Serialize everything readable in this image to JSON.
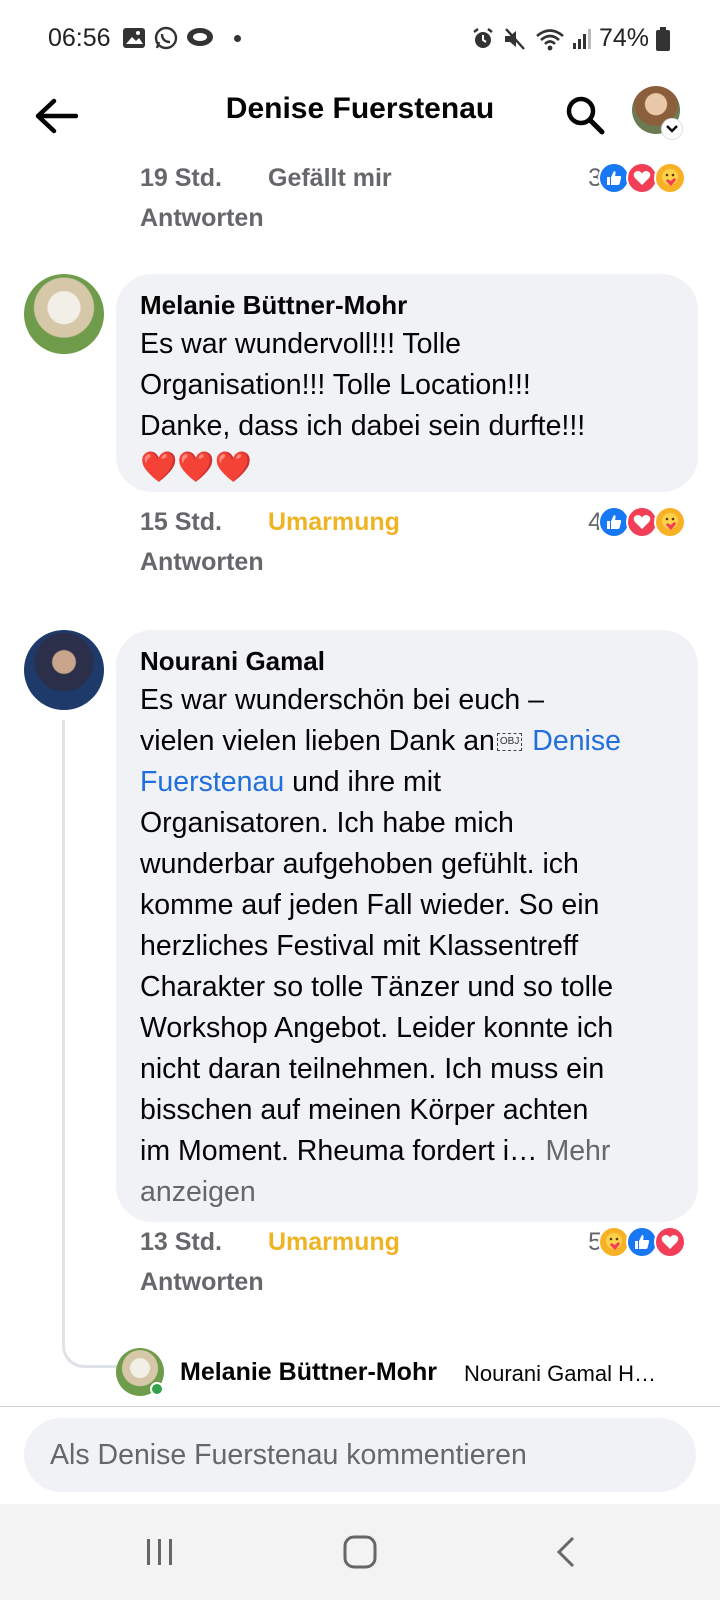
{
  "status_bar": {
    "time": "06:56",
    "battery": "74%"
  },
  "app_bar": {
    "title": "Denise Fuerstenau"
  },
  "top_meta": {
    "time": "19 Std.",
    "reaction": "Gefällt mir",
    "reply": "Antworten",
    "count": "3"
  },
  "comments": [
    {
      "author": "Melanie Büttner-Mohr",
      "lines": [
        "Es war wundervoll!!! Tolle",
        "Organisation!!! Tolle Location!!!",
        "Danke, dass ich dabei sein durfte!!!"
      ],
      "emoji": "❤️❤️❤️",
      "time": "15 Std.",
      "reaction": "Umarmung",
      "reply": "Antworten",
      "count": "4"
    },
    {
      "author": "Nourani Gamal",
      "line1": "Es war wunderschön bei euch –",
      "line2_pre": "vielen vielen lieben Dank an",
      "obj_marker": "OBJ",
      "mention_part1": " Denise",
      "mention_part2": "Fuerstenau",
      "line3_post": " und ihre mit",
      "lines_rest": [
        "Organisatoren. Ich habe mich",
        "wunderbar aufgehoben gefühlt. ich",
        "komme auf jeden Fall wieder. So ein",
        "herzliches Festival mit Klassentreff",
        "Charakter so tolle Tänzer und so tolle",
        "Workshop Angebot. Leider konnte ich",
        "nicht daran teilnehmen. Ich muss ein",
        "bisschen auf meinen Körper achten"
      ],
      "last_line": "im Moment. Rheuma fordert i…",
      "more_1": " Mehr",
      "more_2": "anzeigen",
      "time": "13 Std.",
      "reaction": "Umarmung",
      "reply": "Antworten",
      "count": "5"
    }
  ],
  "reply_preview": {
    "author": "Melanie Büttner-Mohr",
    "snippet": "Nourani Gamal H…"
  },
  "composer": {
    "placeholder": "Als Denise Fuerstenau kommentieren"
  },
  "colors": {
    "like": "#1877f2",
    "love": "#f33e58",
    "hug": "#f7b125",
    "reaction_text": "#f0b324",
    "link": "#216fdb",
    "bubble": "#f0f2f5",
    "secondary_text": "#65676b"
  }
}
